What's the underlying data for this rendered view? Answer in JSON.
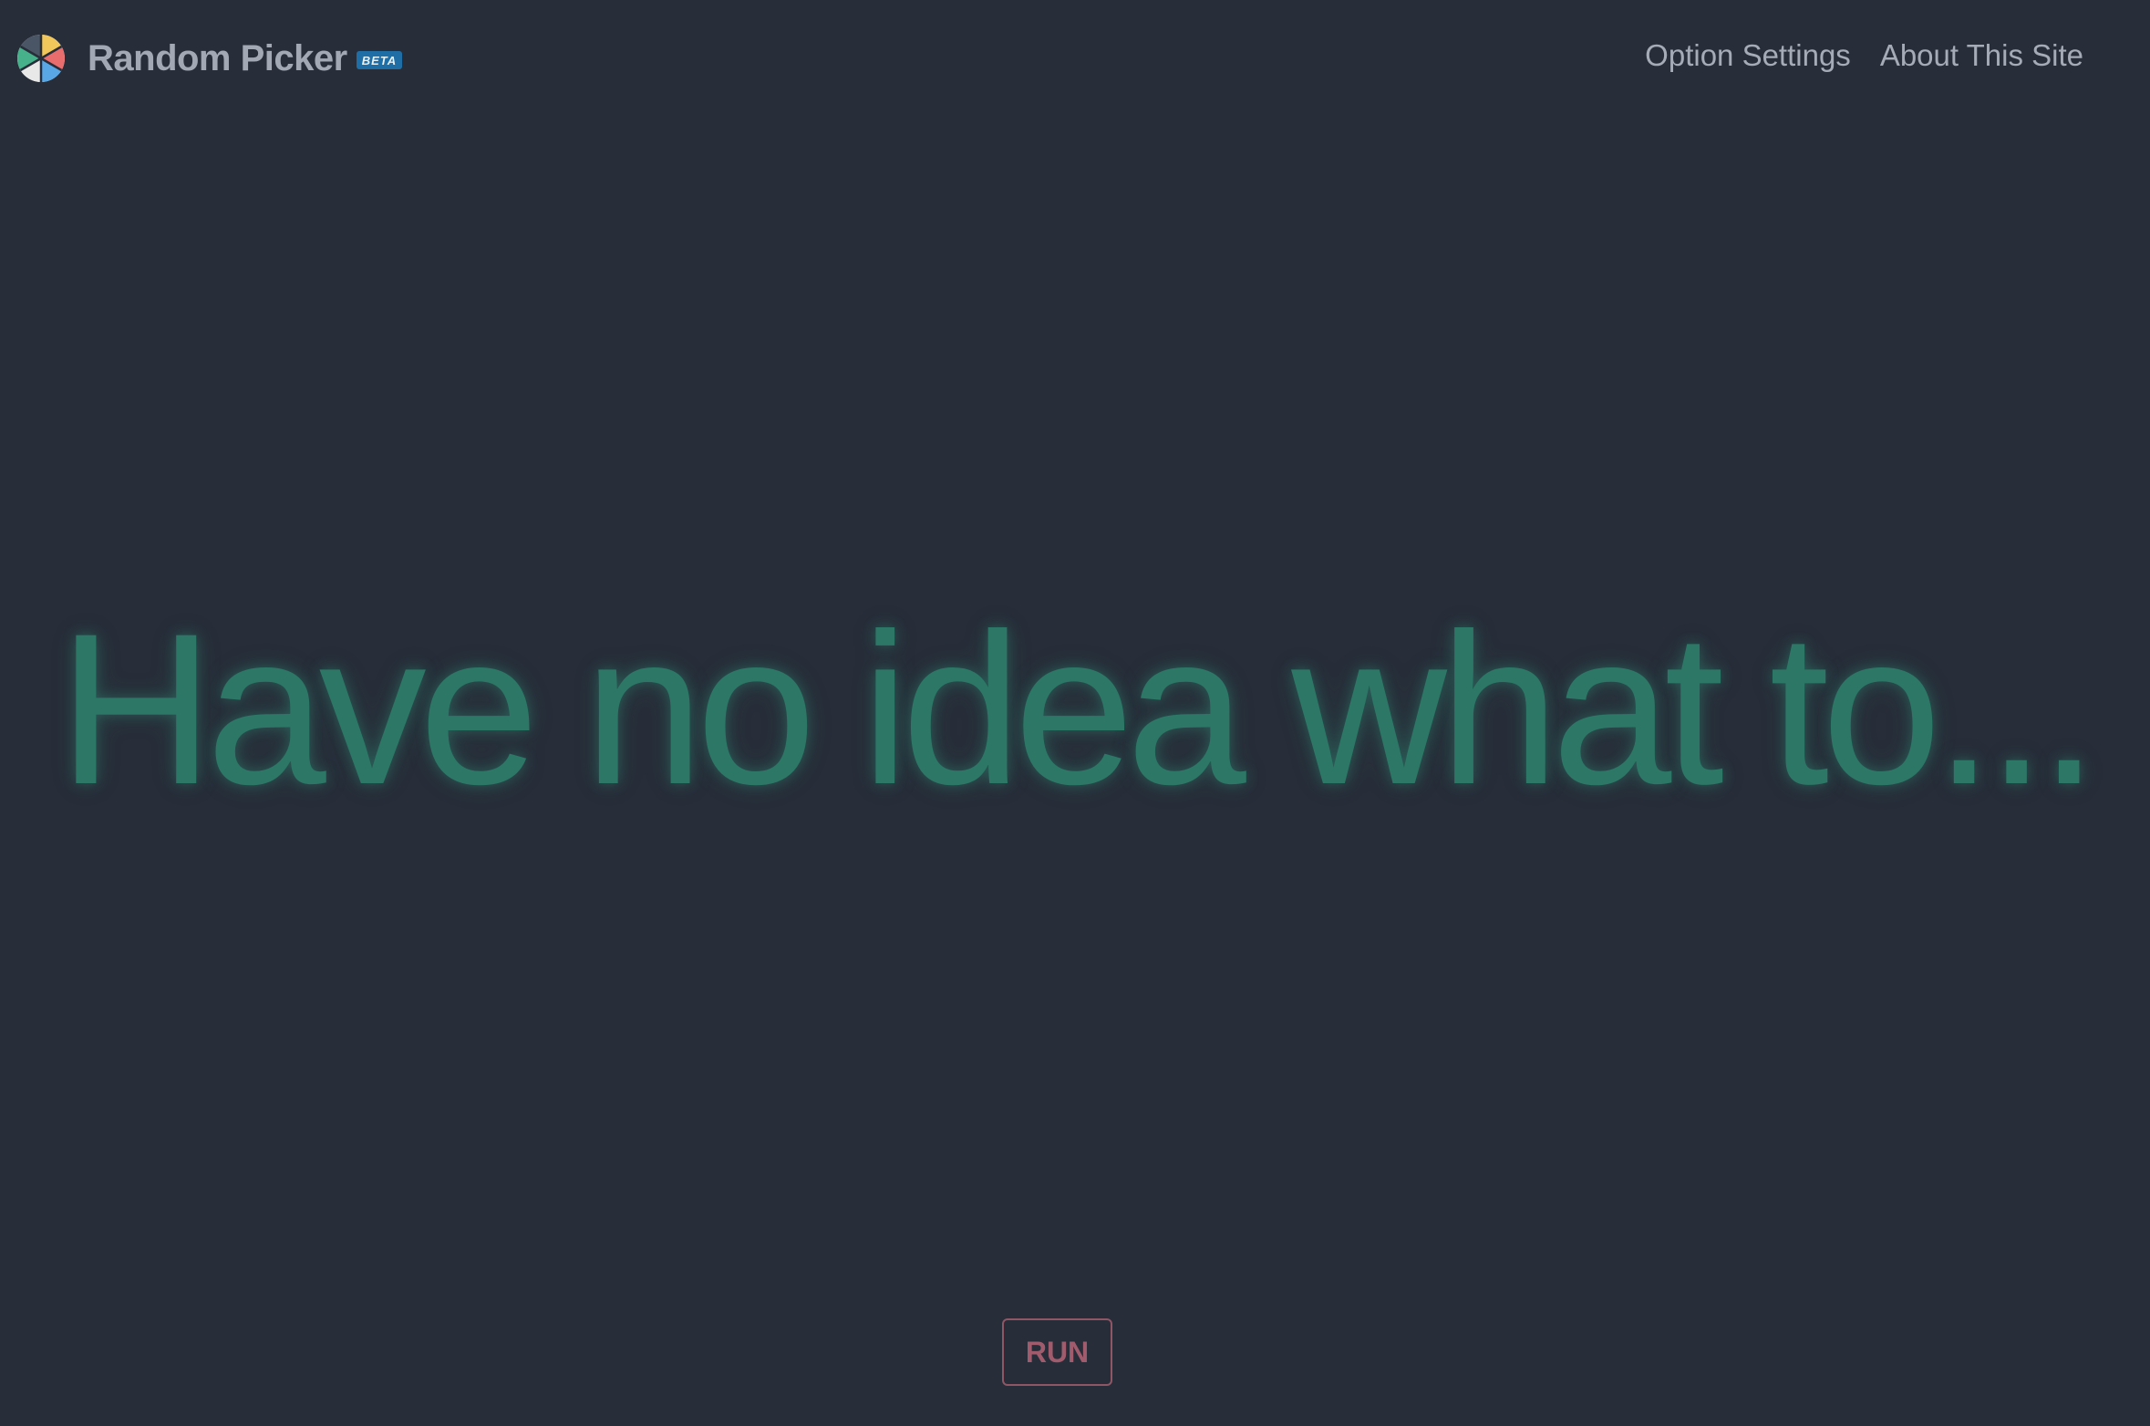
{
  "header": {
    "app_name": "Random Picker",
    "badge": "BETA",
    "logo_icon": "pie-wheel-icon",
    "nav": [
      {
        "label": "Option Settings"
      },
      {
        "label": "About This Site"
      }
    ]
  },
  "main": {
    "headline": "Have no idea what to..."
  },
  "actions": {
    "run_label": "RUN"
  },
  "colors": {
    "background": "#272d39",
    "headline": "#2d7766",
    "run_button": "#a05c6d",
    "badge": "#1f6fa6",
    "logo_segments": [
      "#ea6d6d",
      "#f1c65a",
      "#5aa7e6",
      "#46b18b",
      "#e8e8e8",
      "#4a5566"
    ]
  }
}
